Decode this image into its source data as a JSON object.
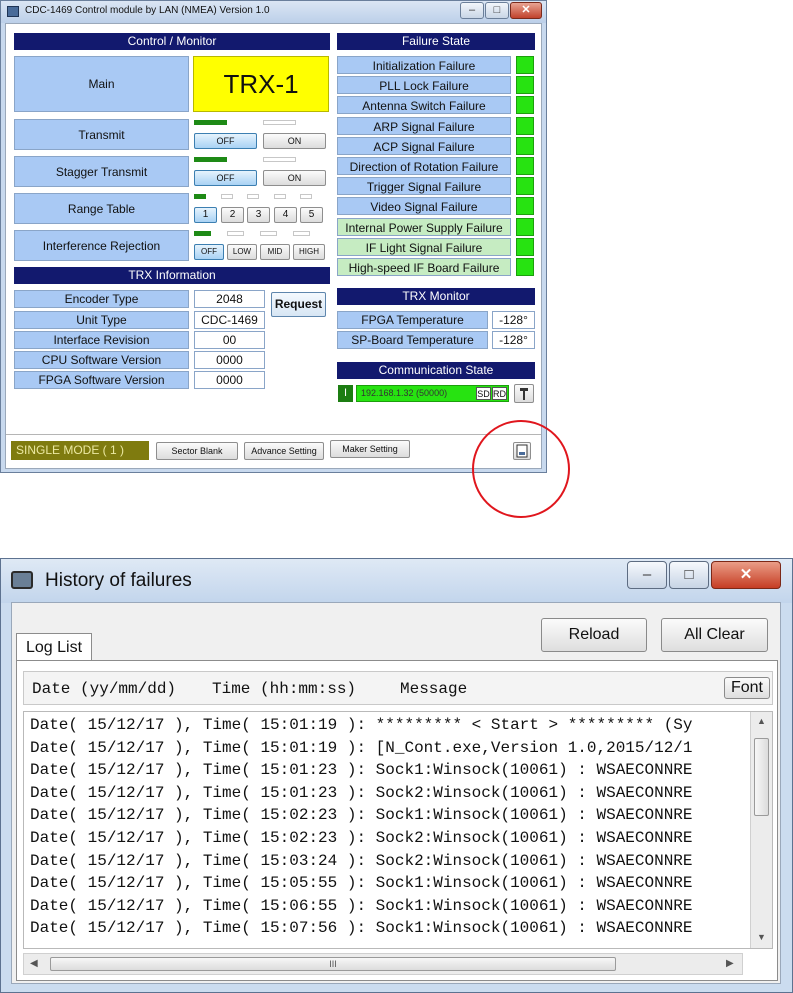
{
  "control_window": {
    "title": "CDC-1469 Control module by LAN (NMEA) Version 1.0",
    "caption_minimize": "–",
    "caption_maximize": "□",
    "caption_close": "✕",
    "control_monitor": {
      "header": "Control / Monitor",
      "main_label": "Main",
      "main_value": "TRX-1",
      "transmit_label": "Transmit",
      "stagger_label": "Stagger Transmit",
      "range_label": "Range Table",
      "interference_label": "Interference Rejection",
      "off": "OFF",
      "on": "ON",
      "range_buttons": [
        "1",
        "2",
        "3",
        "4",
        "5"
      ],
      "interference_buttons": [
        "OFF",
        "LOW",
        "MID",
        "HIGH"
      ]
    },
    "trx_information": {
      "header": "TRX Information",
      "rows": [
        {
          "label": "Encoder Type",
          "value": "2048"
        },
        {
          "label": "Unit Type",
          "value": "CDC-1469"
        },
        {
          "label": "Interface Revision",
          "value": "00"
        },
        {
          "label": "CPU Software Version",
          "value": "0000"
        },
        {
          "label": "FPGA Software Version",
          "value": "0000"
        }
      ],
      "request_button": "Request"
    },
    "failure_state": {
      "header": "Failure State",
      "items": [
        "Initialization Failure",
        "PLL Lock Failure",
        "Antenna Switch Failure",
        "ARP Signal Failure",
        "ACP Signal Failure",
        "Direction of Rotation Failure",
        "Trigger Signal Failure",
        "Video Signal Failure",
        "Internal Power Supply Failure",
        "IF Light Signal Failure",
        "High-speed IF Board Failure"
      ],
      "status_color": "#27e311"
    },
    "trx_monitor": {
      "header": "TRX Monitor",
      "rows": [
        {
          "label": "FPGA Temperature",
          "value": "-128°"
        },
        {
          "label": "SP-Board Temperature",
          "value": "-128°"
        }
      ]
    },
    "communication_state": {
      "header": "Communication State",
      "indicator": "I",
      "address": "192.168.1.32 (50000)",
      "sd": "SD",
      "rd": "RD"
    },
    "bottom": {
      "mode": "SINGLE MODE ( 1 )",
      "sector_blank": "Sector Blank",
      "advance_setting": "Advance Setting",
      "maker_setting": "Maker Setting"
    }
  },
  "history_window": {
    "title": "History of failures",
    "caption_minimize": "–",
    "caption_maximize": "□",
    "caption_close": "✕",
    "tab_label": "Log List",
    "reload_button": "Reload",
    "all_clear_button": "All Clear",
    "font_button": "Font",
    "columns": [
      "Date (yy/mm/dd)",
      "Time (hh:mm:ss)",
      "Message"
    ],
    "log_rows": [
      "Date( 15/12/17 ), Time( 15:01:19 ): ********* < Start > ********* (Sy",
      "Date( 15/12/17 ), Time( 15:01:19 ): [N_Cont.exe,Version 1.0,2015/12/1",
      "Date( 15/12/17 ), Time( 15:01:23 ): Sock1:Winsock(10061) : WSAECONNRE",
      "Date( 15/12/17 ), Time( 15:01:23 ): Sock2:Winsock(10061) : WSAECONNRE",
      "Date( 15/12/17 ), Time( 15:02:23 ): Sock1:Winsock(10061) : WSAECONNRE",
      "Date( 15/12/17 ), Time( 15:02:23 ): Sock2:Winsock(10061) : WSAECONNRE",
      "Date( 15/12/17 ), Time( 15:03:24 ): Sock2:Winsock(10061) : WSAECONNRE",
      "Date( 15/12/17 ), Time( 15:05:55 ): Sock1:Winsock(10061) : WSAECONNRE",
      "Date( 15/12/17 ), Time( 15:06:55 ): Sock1:Winsock(10061) : WSAECONNRE",
      "Date( 15/12/17 ), Time( 15:07:56 ): Sock1:Winsock(10061) : WSAECONNRE"
    ],
    "scroll_grip": "III",
    "annotation_color": "#e0161d"
  }
}
